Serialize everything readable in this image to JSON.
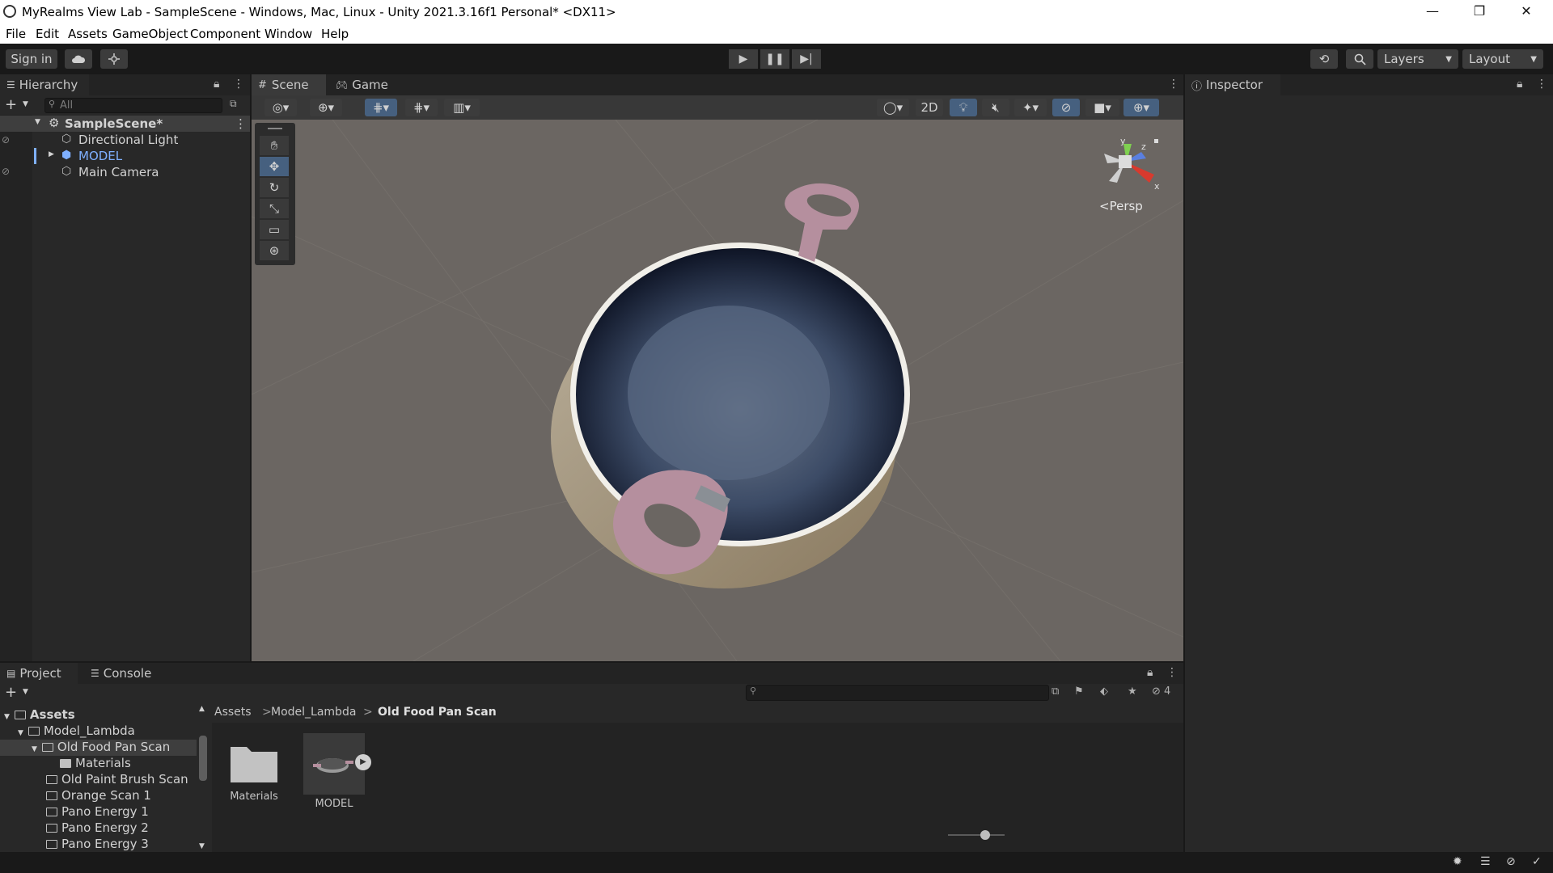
{
  "window": {
    "title": "MyRealms View Lab - SampleScene - Windows, Mac, Linux - Unity 2021.3.16f1 Personal* <DX11>",
    "controls": {
      "minimize": "—",
      "restore": "❐",
      "close": "✕"
    }
  },
  "menu": [
    "File",
    "Edit",
    "Assets",
    "GameObject",
    "Component",
    "Window",
    "Help"
  ],
  "toolbar": {
    "sign_in": "Sign in",
    "layers": "Layers",
    "layout": "Layout",
    "play_icons": [
      "play-icon",
      "pause-icon",
      "step-icon"
    ]
  },
  "hierarchy": {
    "tab_label": "Hierarchy",
    "search_placeholder": "All",
    "scene_name": "SampleScene*",
    "items": [
      {
        "label": "Directional Light",
        "color": "#d2d2d2"
      },
      {
        "label": "MODEL",
        "color": "#7fb0ff"
      },
      {
        "label": "Main Camera",
        "color": "#d2d2d2"
      }
    ]
  },
  "scene": {
    "tabs": [
      {
        "label": "Scene",
        "icon": "grid-icon",
        "active": true
      },
      {
        "label": "Game",
        "icon": "gamepad-icon",
        "active": false
      }
    ],
    "toggle_2d": "2D",
    "gizmo": {
      "x": "x",
      "y": "y",
      "z": "z",
      "projection": "Persp"
    },
    "background": "#6b6662"
  },
  "inspector": {
    "tab_label": "Inspector"
  },
  "project": {
    "tabs": [
      {
        "label": "Project",
        "active": true
      },
      {
        "label": "Console",
        "active": false
      }
    ],
    "hidden_count": "4",
    "tree": [
      {
        "label": "Assets",
        "level": 0,
        "bold": true
      },
      {
        "label": "Model_Lambda",
        "level": 1
      },
      {
        "label": "Old Food Pan Scan",
        "level": 2,
        "selected": true
      },
      {
        "label": "Materials",
        "level": 3
      },
      {
        "label": "Old Paint Brush Scan",
        "level": 2
      },
      {
        "label": "Orange Scan 1",
        "level": 2
      },
      {
        "label": "Pano Energy 1",
        "level": 2
      },
      {
        "label": "Pano Energy 2",
        "level": 2
      },
      {
        "label": "Pano Energy 3",
        "level": 2
      }
    ],
    "breadcrumb": [
      "Assets",
      "Model_Lambda",
      "Old Food Pan Scan"
    ],
    "assets": [
      {
        "label": "Materials",
        "type": "folder"
      },
      {
        "label": "MODEL",
        "type": "model"
      }
    ],
    "zoom_level": 0.65
  }
}
